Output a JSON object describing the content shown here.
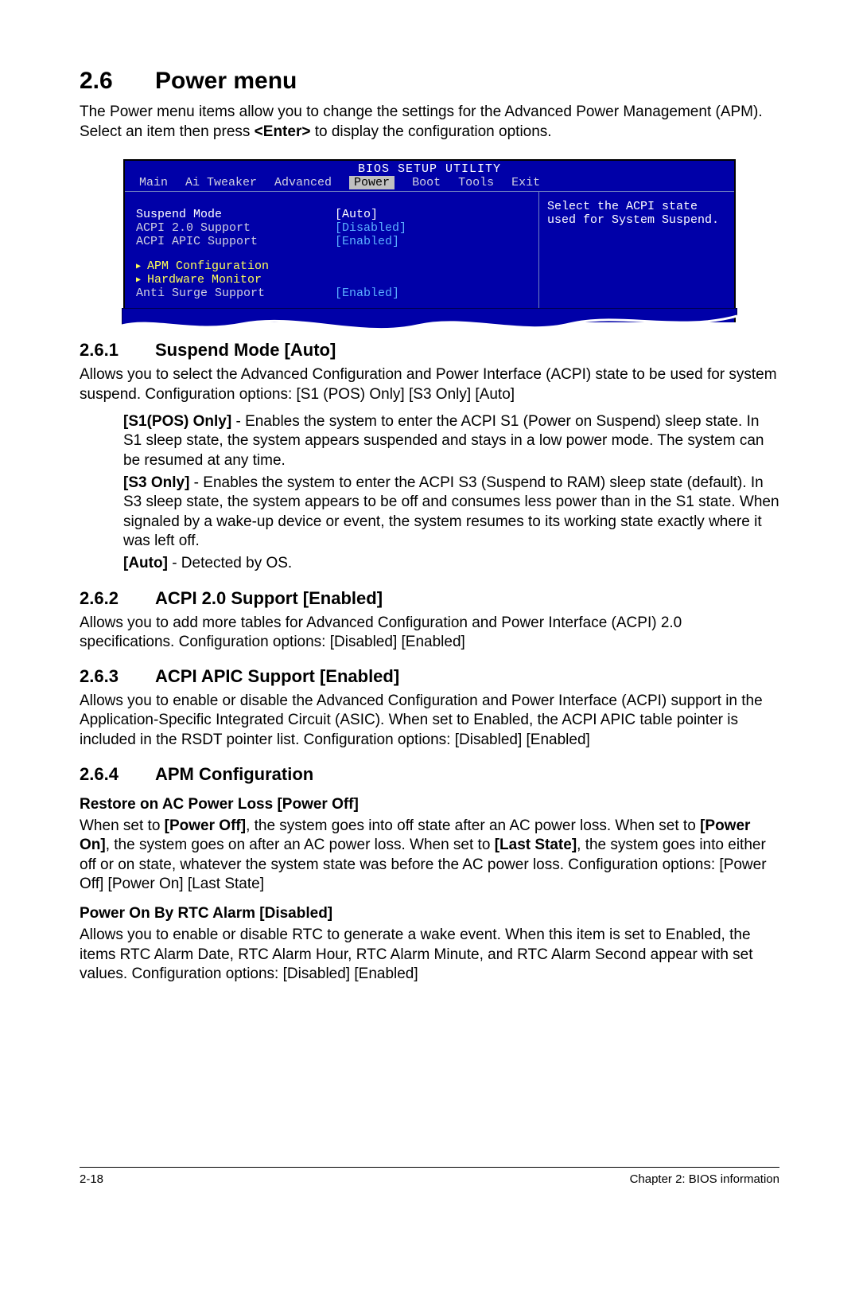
{
  "section": {
    "num": "2.6",
    "title": "Power menu",
    "intro_a": "The Power menu items allow you to change the settings for the Advanced Power Management (APM). Select an item then press ",
    "intro_key": "<Enter>",
    "intro_b": " to display the configuration options."
  },
  "bios": {
    "title": "BIOS SETUP UTILITY",
    "tabs": [
      "Main",
      "Ai Tweaker",
      "Advanced",
      "Power",
      "Boot",
      "Tools",
      "Exit"
    ],
    "selected_tab": "Power",
    "rows": [
      {
        "label": "Suspend Mode",
        "value": "[Auto]",
        "selected": true
      },
      {
        "label": "ACPI 2.0 Support",
        "value": "[Disabled]"
      },
      {
        "label": "ACPI APIC Support",
        "value": "[Enabled]"
      }
    ],
    "subs": [
      {
        "label": "APM Configuration"
      },
      {
        "label": "Hardware Monitor"
      }
    ],
    "tail": {
      "label": "Anti Surge Support",
      "value": "[Enabled]"
    },
    "help": "Select the ACPI state used for System Suspend."
  },
  "s261": {
    "num": "2.6.1",
    "title": "Suspend Mode [Auto]",
    "body": "Allows you to select the Advanced Configuration and Power Interface (ACPI) state to be used for system suspend. Configuration options: [S1 (POS) Only] [S3 Only] [Auto]",
    "opt1_k": "[S1(POS) Only]",
    "opt1_t": " - Enables the system to enter the ACPI S1 (Power on Suspend) sleep state. In S1 sleep state, the system appears suspended and stays in a low power mode. The system can be resumed at any time.",
    "opt2_k": "[S3 Only]",
    "opt2_t": " - Enables the system to enter the ACPI S3 (Suspend to RAM) sleep state (default). In S3 sleep state, the system appears to be off and consumes less power than in the S1 state. When signaled by a wake-up device or event, the system resumes to its working state exactly where it was left off.",
    "opt3_k": "[Auto]",
    "opt3_t": " - Detected by OS."
  },
  "s262": {
    "num": "2.6.2",
    "title": "ACPI 2.0 Support [Enabled]",
    "body": "Allows you to add more tables for Advanced Configuration and Power Interface (ACPI) 2.0 specifications. Configuration options: [Disabled] [Enabled]"
  },
  "s263": {
    "num": "2.6.3",
    "title": "ACPI APIC Support [Enabled]",
    "body": "Allows you to enable or disable the Advanced Configuration and Power Interface (ACPI) support in the Application-Specific Integrated Circuit (ASIC). When set to Enabled, the ACPI APIC table pointer is included in the RSDT pointer list. Configuration options: [Disabled] [Enabled]"
  },
  "s264": {
    "num": "2.6.4",
    "title": "APM Configuration",
    "sub1_title": "Restore on AC Power Loss [Power Off]",
    "sub1_a": "When set to ",
    "sub1_k1": "[Power Off]",
    "sub1_b": ", the system goes into off state after an AC power loss. When set to ",
    "sub1_k2": "[Power On]",
    "sub1_c": ", the system goes on after an AC power loss. When set to ",
    "sub1_k3": "[Last State]",
    "sub1_d": ", the system goes into either off or on state, whatever the system state was before the AC power loss. Configuration options: [Power Off] [Power On] [Last State]",
    "sub2_title": "Power On By RTC Alarm [Disabled]",
    "sub2_body": "Allows you to enable or disable RTC to generate a wake event. When this item is set to Enabled, the items RTC Alarm Date, RTC Alarm Hour, RTC Alarm Minute, and RTC Alarm Second appear with set values. Configuration options: [Disabled] [Enabled]"
  },
  "footer": {
    "page": "2-18",
    "chapter": "Chapter 2: BIOS information"
  }
}
